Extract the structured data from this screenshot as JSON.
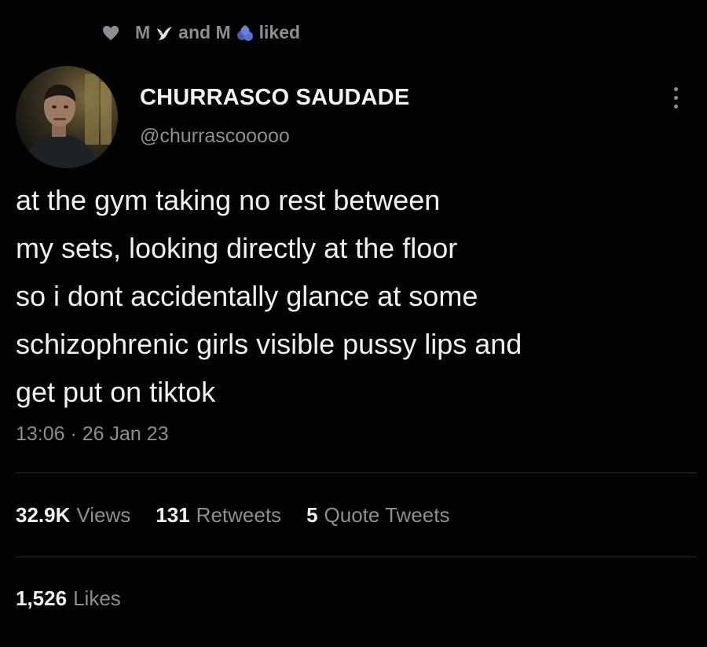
{
  "social_context": {
    "text_before": "M",
    "text_middle": "and M",
    "text_after": "liked",
    "icons": [
      "heart-icon",
      "dove-icon",
      "blueberry-icon"
    ]
  },
  "author": {
    "display_name": "CHURRASCO SAUDADE",
    "handle": "@churrascooooo"
  },
  "tweet": {
    "text": "at the gym taking no rest between\nmy sets, looking directly at the floor\nso i dont accidentally glance at some\nschizophrenic girls visible pussy lips and\nget put on tiktok",
    "timestamp": "13:06 · 26 Jan 23"
  },
  "stats": {
    "views_count": "32.9K",
    "views_label": "Views",
    "retweets_count": "131",
    "retweets_label": "Retweets",
    "quotes_count": "5",
    "quotes_label": "Quote Tweets",
    "likes_count": "1,526",
    "likes_label": "Likes"
  },
  "colors": {
    "background": "#020202",
    "primary_text": "#f0f1f2",
    "secondary_text": "#8b8f94",
    "divider": "#2a2d30"
  }
}
